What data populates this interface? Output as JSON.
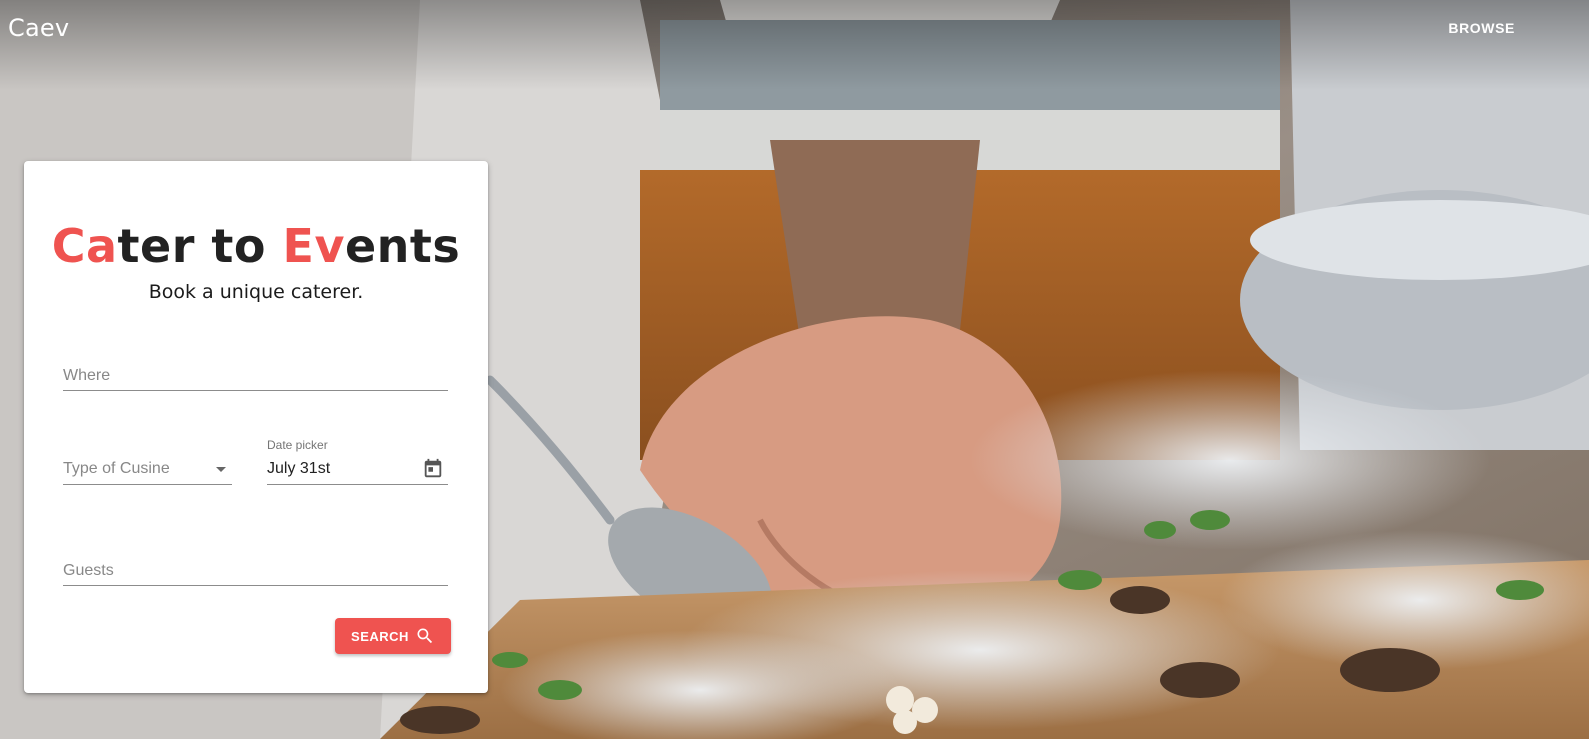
{
  "app": {
    "brand": "Caev",
    "nav": {
      "browse_label": "BROWSE"
    }
  },
  "hero": {
    "title_accent_1": "Ca",
    "title_part_1": "ter to ",
    "title_accent_2": "Ev",
    "title_part_2": "ents",
    "subtitle": "Book a unique caterer."
  },
  "form": {
    "where": {
      "placeholder": "Where",
      "value": ""
    },
    "cuisine": {
      "placeholder": "Type of Cusine"
    },
    "date": {
      "label": "Date picker",
      "value": "July 31st",
      "icon": "calendar-icon"
    },
    "guests": {
      "placeholder": "Guests",
      "value": ""
    },
    "search": {
      "label": "SEARCH",
      "icon": "search-icon"
    }
  },
  "colors": {
    "accent": "#ef5350",
    "card_background": "#ffffff",
    "text": "#222222"
  }
}
